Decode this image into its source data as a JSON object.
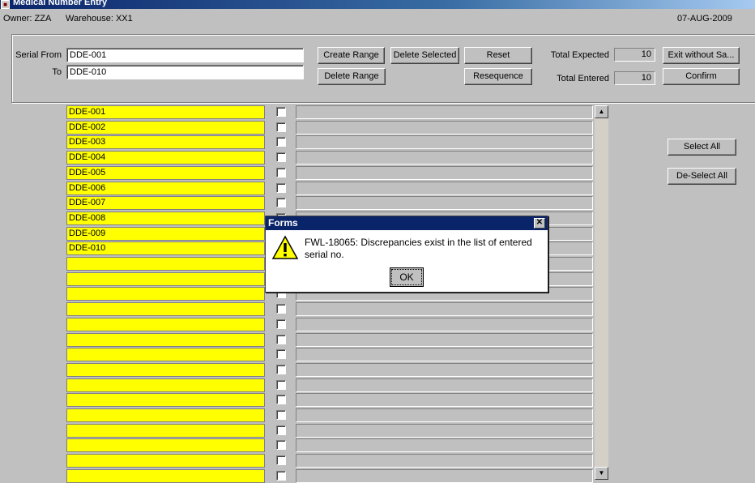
{
  "window": {
    "title": "Medical Number Entry"
  },
  "info": {
    "owner": "Owner:  ZZA",
    "warehouse": "Warehouse:  XX1",
    "date": "07-AUG-2009"
  },
  "form": {
    "serial_from_label": "Serial From",
    "serial_from_value": "DDE-001",
    "to_label": "To",
    "to_value": "DDE-010",
    "total_expected_label": "Total Expected",
    "total_expected_value": "10",
    "total_entered_label": "Total Entered",
    "total_entered_value": "10"
  },
  "buttons": {
    "create_range": "Create Range",
    "delete_selected": "Delete Selected",
    "reset": "Reset",
    "exit_without_save": "Exit without Sa...",
    "delete_range": "Delete Range",
    "resequence": "Resequence",
    "confirm": "Confirm",
    "select_all": "Select All",
    "deselect_all": "De-Select All"
  },
  "serials": [
    "DDE-001",
    "DDE-002",
    "DDE-003",
    "DDE-004",
    "DDE-005",
    "DDE-006",
    "DDE-007",
    "DDE-008",
    "DDE-009",
    "DDE-010",
    "",
    "",
    "",
    "",
    "",
    "",
    "",
    "",
    "",
    "",
    "",
    "",
    "",
    "",
    "",
    ""
  ],
  "dialog": {
    "title": "Forms",
    "message": "FWL-18065:  Discrepancies exist in the list of entered serial no.",
    "ok_label": "OK",
    "icon": "warning-icon"
  },
  "colors": {
    "serial_bg": "#ffff00",
    "title_bar": "#0a246a"
  }
}
